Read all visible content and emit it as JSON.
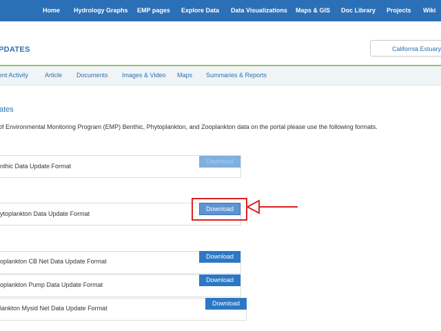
{
  "top_nav": {
    "items": [
      "Home",
      "Hydrology Graphs",
      "EMP pages",
      "Explore Data",
      "Data Visualizations",
      "Maps & GIS",
      "Doc Library",
      "Projects",
      "Wiki"
    ]
  },
  "header": {
    "title": "PDATES",
    "estuary_button": "California Estuary"
  },
  "sub_nav": {
    "tabs": [
      "ent Activity",
      "Article",
      "Documents",
      "Images & Video",
      "Maps",
      "Summaries & Reports"
    ]
  },
  "main": {
    "section_title": "ates",
    "intro": " of Environmental Monitoring Program (EMP) Benthic, Phytoplankton, and Zooplankton data on the portal please use the following formats.",
    "rows": [
      {
        "label": "nthic Data Update Format",
        "button": "Download"
      },
      {
        "label": "ytoplankton Data Update Format",
        "button": "Download"
      },
      {
        "label": "oplankton CB Net Data Update Format",
        "button": "Download"
      },
      {
        "label": "oplankton Pump Data Update Format",
        "button": "Download"
      },
      {
        "label": "lankton Mysid Net Data Update Format",
        "button": "Download"
      }
    ]
  },
  "colors": {
    "nav_bg": "#2b6fb6",
    "link": "#2c6fb0",
    "accent_green": "#8fbf6e",
    "highlight_red": "#d9201f"
  }
}
